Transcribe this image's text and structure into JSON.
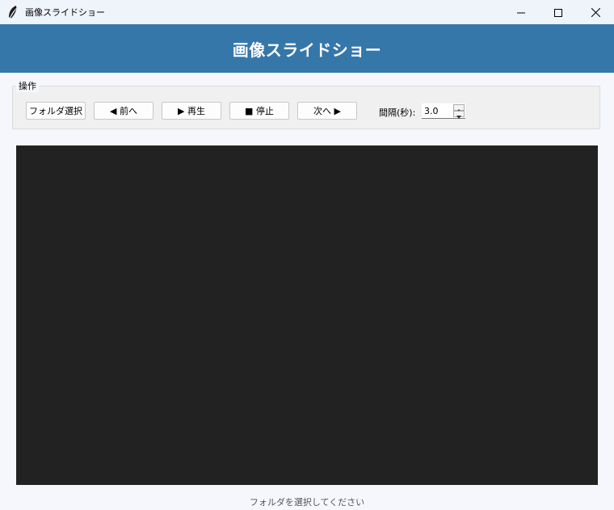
{
  "window": {
    "title": "画像スライドショー"
  },
  "header": {
    "title": "画像スライドショー"
  },
  "controls": {
    "group_label": "操作",
    "folder_button": "フォルダ選択",
    "prev_button": "◀ 前へ",
    "play_button": "▶ 再生",
    "stop_button": "■ 停止",
    "next_button": "次へ ▶",
    "interval_label": "間隔(秒):",
    "interval_value": "3.0"
  },
  "status": {
    "message": "フォルダを選択してください"
  },
  "colors": {
    "header_bg": "#3677aa",
    "canvas_bg": "#222222",
    "titlebar_bg": "#eff3fa"
  },
  "icons": {
    "app": "feather-icon",
    "minimize": "minimize-icon",
    "maximize": "maximize-icon",
    "close": "close-icon"
  }
}
